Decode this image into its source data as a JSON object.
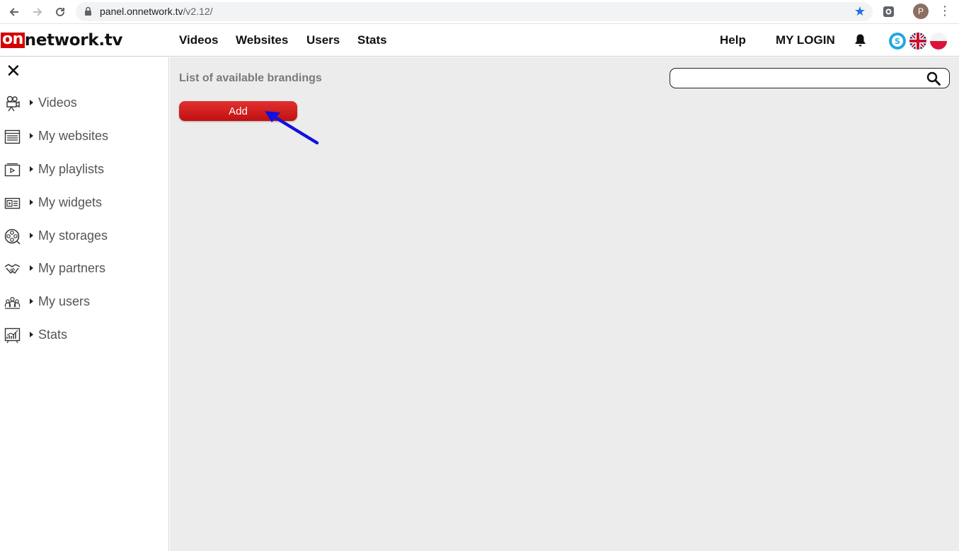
{
  "browser": {
    "url_host": "panel.onnetwork.tv",
    "url_path": "/v2.12/",
    "profile_initial": "P"
  },
  "header": {
    "logo_on": "on",
    "logo_rest": "network.tv",
    "nav": [
      "Videos",
      "Websites",
      "Users",
      "Stats"
    ],
    "help_label": "Help",
    "login_label": "MY LOGIN"
  },
  "sidebar": {
    "close_icon": "close-icon",
    "items": [
      {
        "label": "Videos",
        "icon": "film-camera-icon"
      },
      {
        "label": "My websites",
        "icon": "websites-icon"
      },
      {
        "label": "My playlists",
        "icon": "playlist-icon"
      },
      {
        "label": "My widgets",
        "icon": "widget-icon"
      },
      {
        "label": "My storages",
        "icon": "storage-icon"
      },
      {
        "label": "My partners",
        "icon": "handshake-icon"
      },
      {
        "label": "My users",
        "icon": "users-icon"
      },
      {
        "label": "Stats",
        "icon": "stats-icon"
      }
    ]
  },
  "main": {
    "title": "List of available brandings",
    "add_label": "Add",
    "search": {
      "value": "",
      "placeholder": ""
    }
  },
  "colors": {
    "brand_red": "#d40000",
    "button_red": "#d02020",
    "main_bg": "#ececec",
    "annotation_arrow": "#1010e0"
  }
}
